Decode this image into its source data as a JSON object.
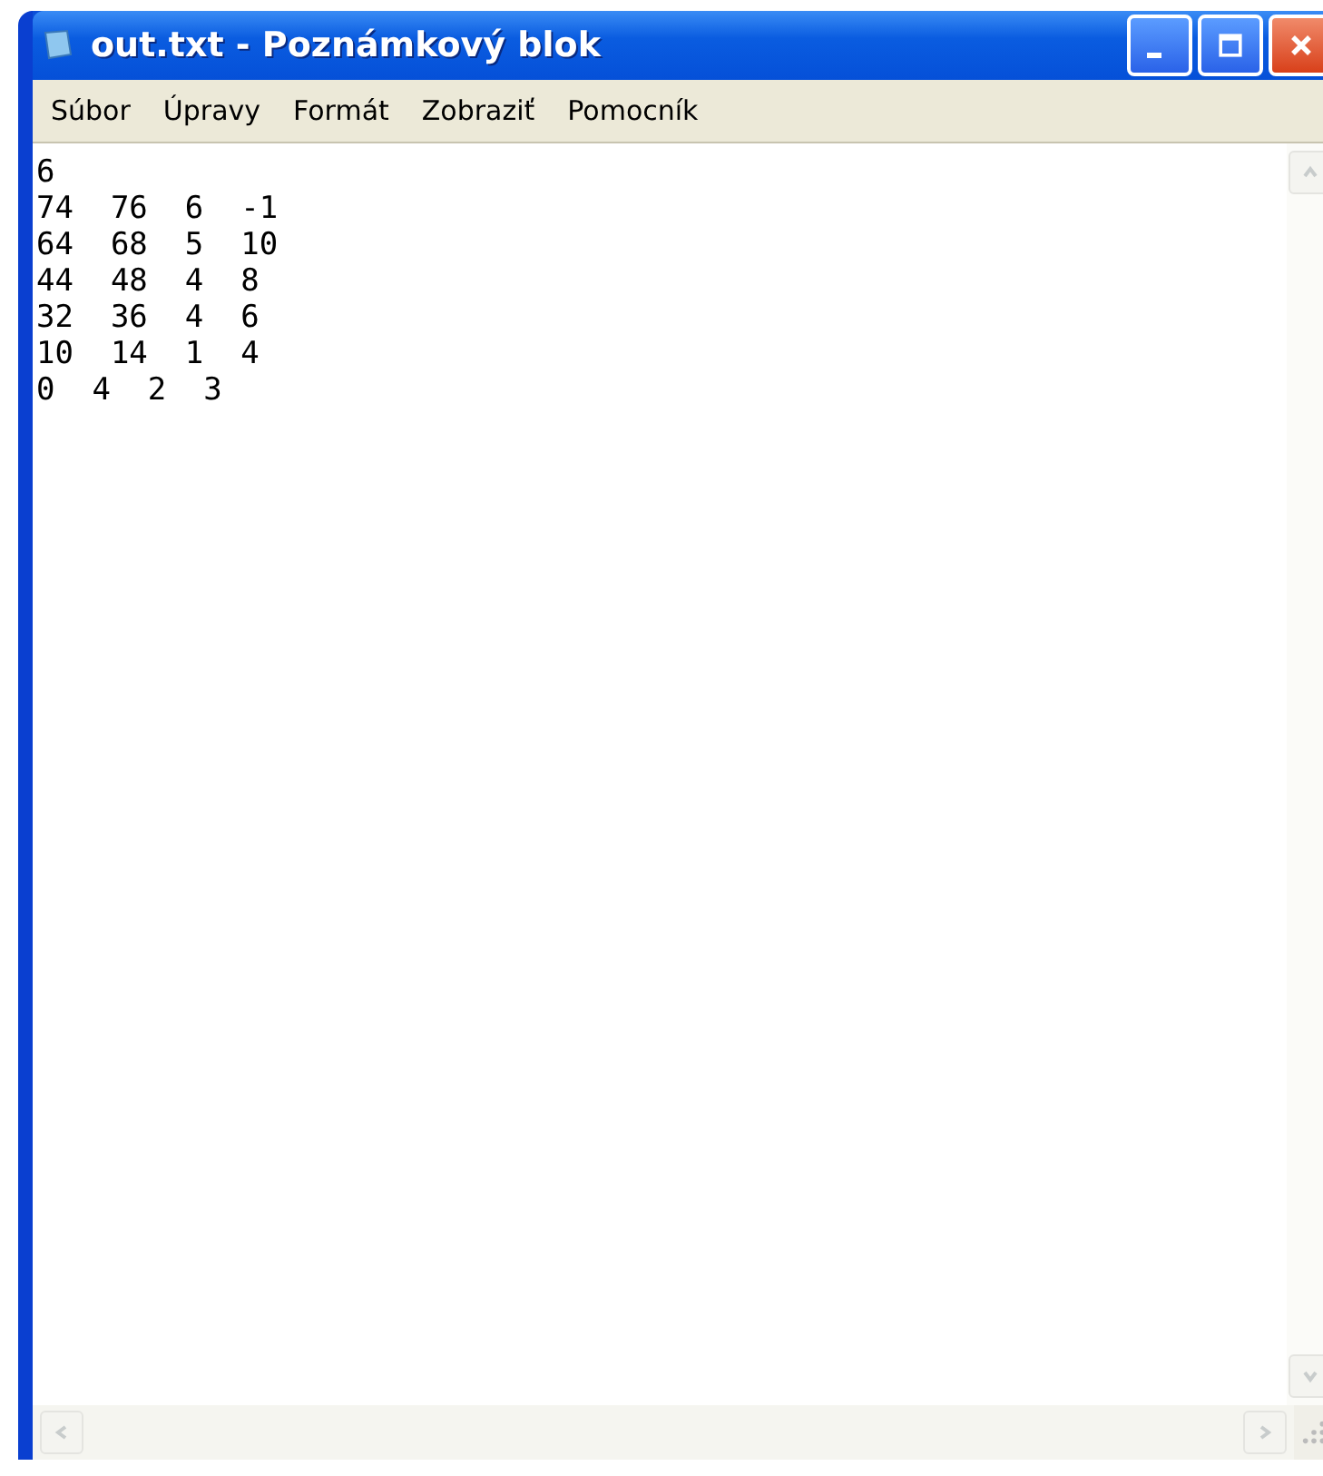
{
  "window": {
    "title": "out.txt - Poznámkový blok"
  },
  "menu": [
    "Súbor",
    "Úpravy",
    "Formát",
    "Zobraziť",
    "Pomocník"
  ],
  "editor": {
    "lines": [
      "6",
      "74  76  6  -1",
      "64  68  5  10",
      "44  48  4  8",
      "32  36  4  6",
      "10  14  1  4",
      "0  4  2  3"
    ]
  }
}
